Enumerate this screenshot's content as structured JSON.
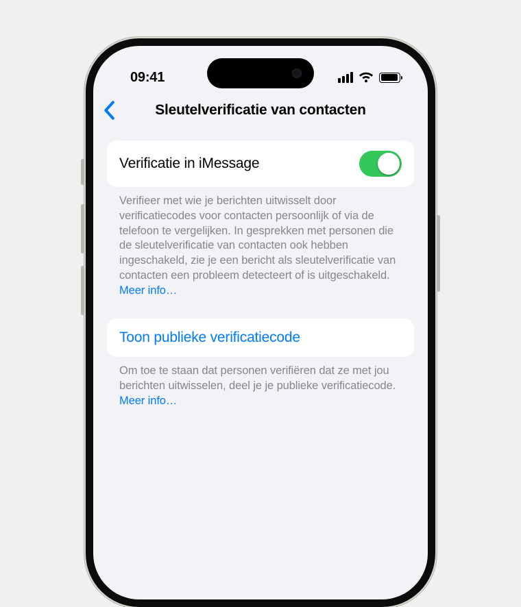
{
  "status": {
    "time": "09:41"
  },
  "nav": {
    "title": "Sleutelverificatie van contacten"
  },
  "group1": {
    "row_label": "Verificatie in iMessage",
    "toggle_on": true,
    "footer_text": "Verifieer met wie je berichten uitwisselt door verificatiecodes voor contacten persoonlijk of via de telefoon te vergelijken. In gesprekken met personen die de sleutelverificatie van contacten ook hebben ingeschakeld, zie je een bericht als sleutelverificatie van contacten een probleem detecteert of is uitgeschakeld. ",
    "footer_link": "Meer info…"
  },
  "group2": {
    "row_label": "Toon publieke verificatiecode",
    "footer_text": "Om toe te staan dat personen verifiëren dat ze met jou berichten uitwisselen, deel je je publieke verificatiecode. ",
    "footer_link": "Meer info…"
  }
}
